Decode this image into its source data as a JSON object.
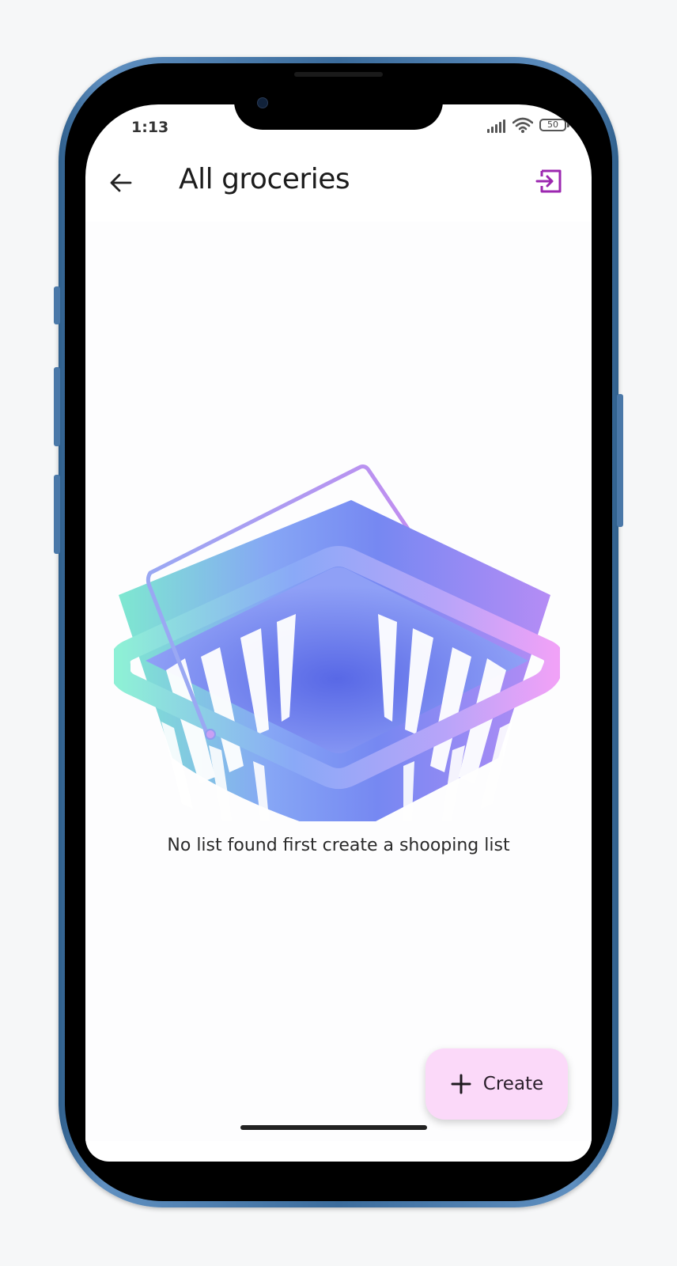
{
  "status_bar": {
    "time": "1:13",
    "battery_level": "50",
    "icons": [
      "signal-icon",
      "wifi-icon",
      "battery-icon"
    ]
  },
  "app_bar": {
    "title": "All groceries",
    "back_icon": "arrow-left-icon",
    "action_icon": "logout-icon"
  },
  "empty_state": {
    "illustration": "shopping-basket-illustration",
    "message": "No list found first create a shooping list"
  },
  "fab": {
    "icon": "plus-icon",
    "label": "Create"
  },
  "colors": {
    "accent": "#9c27b0",
    "fab_background": "#fbd9f9",
    "phone_frame": "#4a78a8",
    "basket_teal": "#7ee8d0",
    "basket_blue": "#6f86f5",
    "basket_pink": "#ee9cf6"
  }
}
